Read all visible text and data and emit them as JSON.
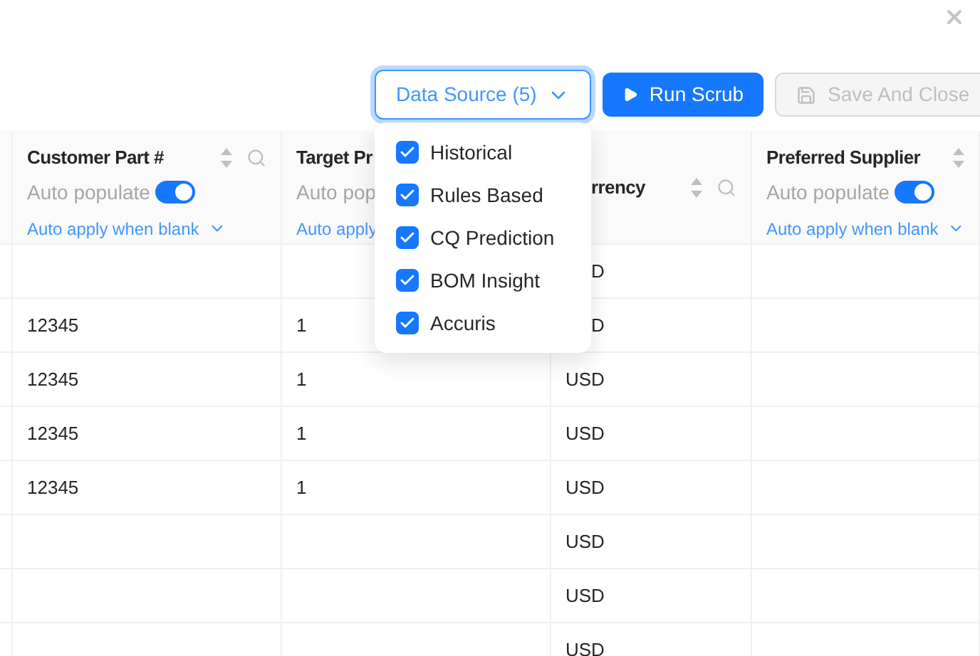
{
  "toolbar": {
    "data_source": {
      "label": "Data Source (5)",
      "expanded": true
    },
    "run_button": {
      "label": "Run Scrub"
    },
    "save_button": {
      "label": "Save And Close",
      "disabled": true
    }
  },
  "dropdown": {
    "options": [
      {
        "label": "Historical",
        "checked": true
      },
      {
        "label": "Rules Based",
        "checked": true
      },
      {
        "label": "CQ Prediction",
        "checked": true
      },
      {
        "label": "BOM Insight",
        "checked": true
      },
      {
        "label": "Accuris",
        "checked": true
      }
    ]
  },
  "table": {
    "columns": [
      {
        "title": "Customer Part #",
        "auto_populate_label": "Auto populate",
        "auto_populate_on": true,
        "auto_apply": "Auto apply when blank",
        "sortable": true,
        "searchable": true,
        "clipped": false
      },
      {
        "title": "Target Pr",
        "auto_populate_label": "Auto pop",
        "auto_apply": "Auto apply",
        "clipped": false
      },
      {
        "title": "rrency",
        "sortable": true,
        "searchable": true,
        "clipped": true
      },
      {
        "title": "Preferred Supplier",
        "auto_populate_label": "Auto populate",
        "auto_populate_on": true,
        "auto_apply": "Auto apply when blank",
        "sortable": true,
        "clipped": false
      }
    ],
    "rows": [
      {
        "cells": [
          "",
          "",
          "D",
          ""
        ],
        "clipped": true
      },
      {
        "cells": [
          "12345",
          "1",
          "D",
          ""
        ],
        "clipped": true
      },
      {
        "cells": [
          "12345",
          "1",
          "USD",
          ""
        ]
      },
      {
        "cells": [
          "12345",
          "1",
          "USD",
          ""
        ]
      },
      {
        "cells": [
          "12345",
          "1",
          "USD",
          ""
        ]
      },
      {
        "cells": [
          "",
          "",
          "USD",
          ""
        ]
      },
      {
        "cells": [
          "",
          "",
          "USD",
          ""
        ]
      },
      {
        "cells": [
          "",
          "",
          "USD",
          ""
        ]
      }
    ]
  }
}
